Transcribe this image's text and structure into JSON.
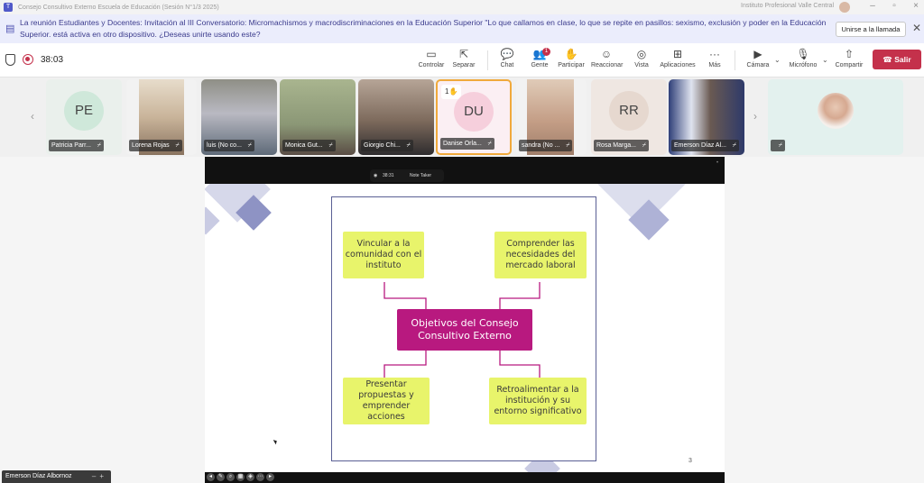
{
  "window": {
    "title": "Consejo Consultivo Externo Escuela de Educación (Sesión N°1/3 2025)",
    "org": "Instituto Profesional Valle Central"
  },
  "banner": {
    "message": "La reunión Estudiantes y Docentes: Invitación al III Conversatorio: Micromachismos y macrodiscriminaciones en la Educación Superior \"Lo que callamos en clase, lo que se repite en pasillos: sexismo, exclusión y poder en la Educación Superior. está activa en otro dispositivo. ¿Deseas unirte usando este?",
    "join_label": "Unirse a la llamada"
  },
  "toolbar": {
    "timer": "38:03",
    "buttons": [
      {
        "label": "Controlar",
        "icon": "control-icon"
      },
      {
        "label": "Separar",
        "icon": "popout-icon"
      },
      {
        "label": "Chat",
        "icon": "chat-icon"
      },
      {
        "label": "Gente",
        "icon": "people-icon",
        "badge": "1"
      },
      {
        "label": "Participar",
        "icon": "raise-hand-icon"
      },
      {
        "label": "Reaccionar",
        "icon": "react-icon"
      },
      {
        "label": "Vista",
        "icon": "view-icon"
      },
      {
        "label": "Aplicaciones",
        "icon": "apps-icon"
      },
      {
        "label": "Más",
        "icon": "more-icon"
      },
      {
        "label": "Cámara",
        "icon": "camera-off-icon"
      },
      {
        "label": "Micrófono",
        "icon": "mic-off-icon"
      },
      {
        "label": "Compartir",
        "icon": "share-icon"
      }
    ],
    "leave_label": "Salir"
  },
  "participants": [
    {
      "name": "Patricia Parr...",
      "initials": "PE",
      "type": "avatar",
      "color": "#cfe8da"
    },
    {
      "name": "Lorena Rojas",
      "initials": "",
      "type": "video",
      "color": "#d6c7b0"
    },
    {
      "name": "luis (No co...",
      "initials": "",
      "type": "video",
      "color": "#7a8a94"
    },
    {
      "name": "Monica Gut...",
      "initials": "",
      "type": "video",
      "color": "#9aa88a"
    },
    {
      "name": "Giorgio Chi...",
      "initials": "",
      "type": "video",
      "color": "#8c7a6a"
    },
    {
      "name": "Danise Orla...",
      "initials": "DU",
      "type": "avatar",
      "color": "#f6cfdc",
      "hand": "1"
    },
    {
      "name": "sandra (No ...",
      "initials": "",
      "type": "video",
      "color": "#c7a58e"
    },
    {
      "name": "Rosa Marga...",
      "initials": "RR",
      "type": "avatar",
      "color": "#e6d8cf"
    },
    {
      "name": "Emerson Díaz Al...",
      "initials": "",
      "type": "video",
      "color": "#3f4f7a"
    },
    {
      "name": "",
      "initials": "",
      "type": "photo",
      "color": "#dff0ec"
    }
  ],
  "shared_screen": {
    "note_taker_time": "38:31",
    "note_taker_label": "Note Taker",
    "center": "Objetivos del Consejo Consultivo Externo",
    "nodes": [
      "Vincular a la comunidad con el instituto",
      "Comprender las necesidades del mercado laboral",
      "Presentar propuestas y emprender acciones",
      "Retroalimentar a la institución y su entorno significativo"
    ],
    "page": "3",
    "colors": {
      "node": "#e8f46b",
      "center": "#b8197f",
      "connector": "#b8197f",
      "frame": "#5a5f94"
    }
  },
  "presenter": {
    "name": "Emerson Díaz Albornoz"
  }
}
